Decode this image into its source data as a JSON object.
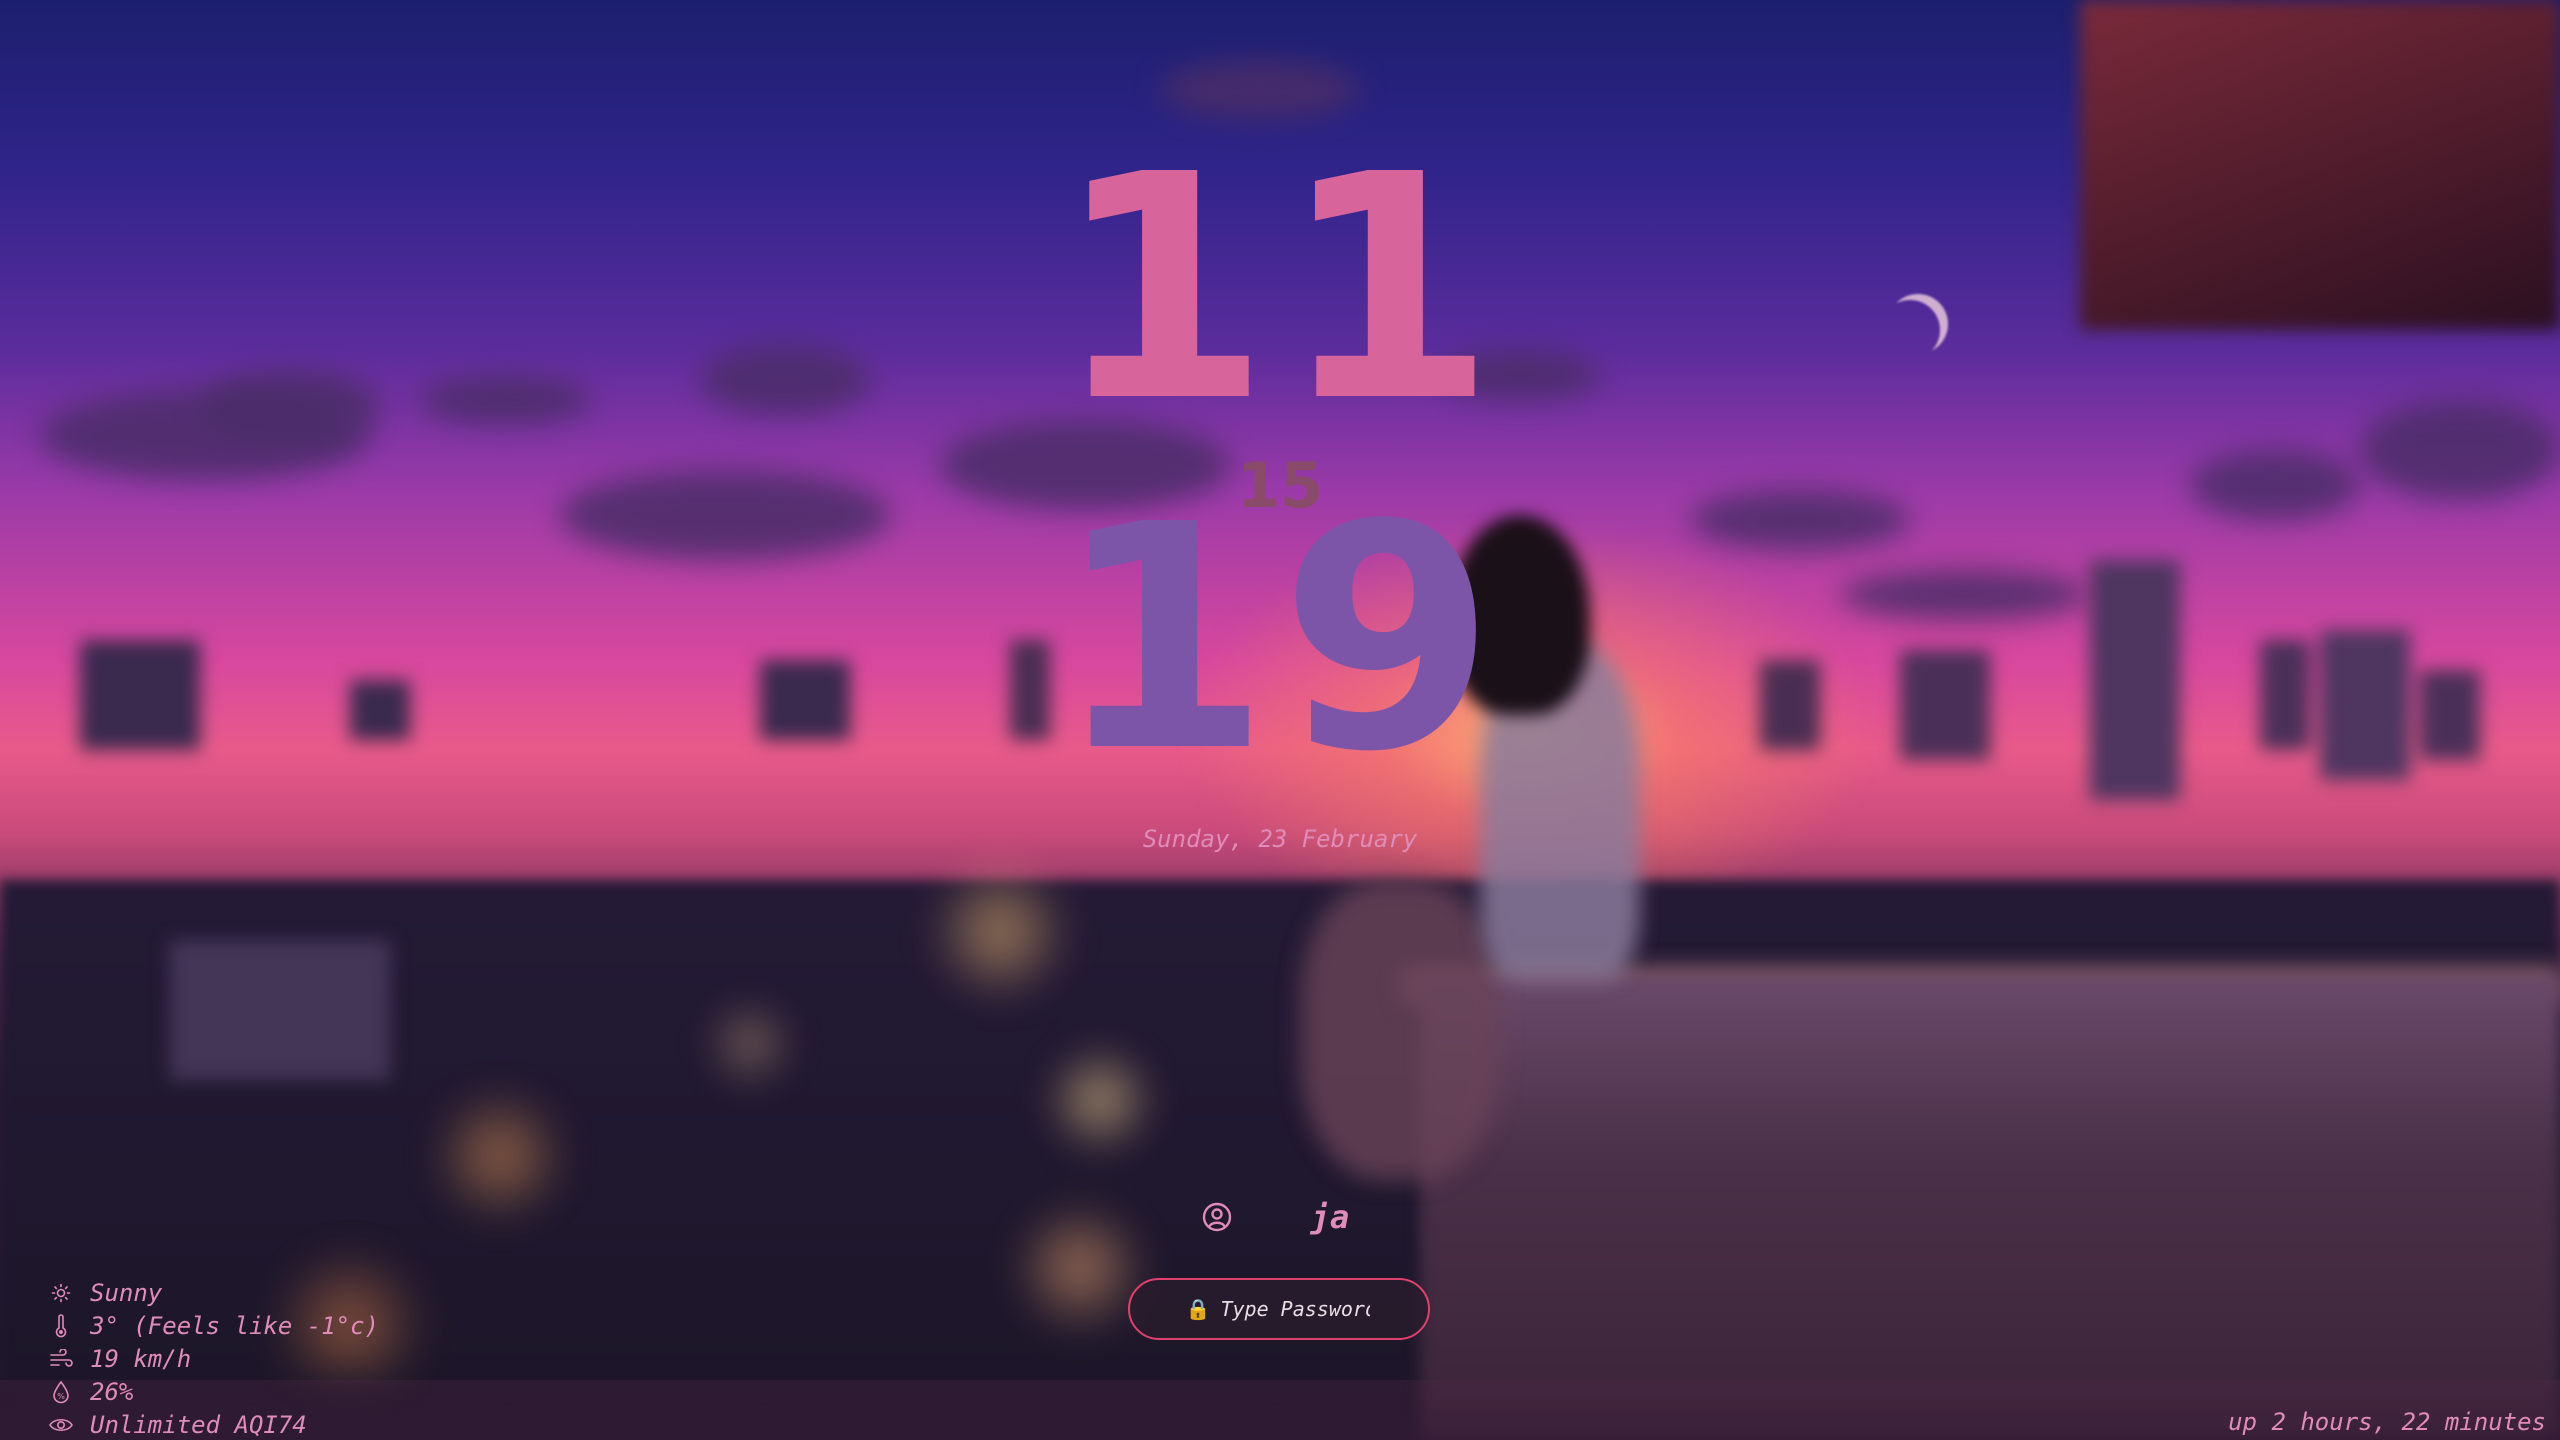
{
  "clock": {
    "hours": "11",
    "seconds": "15",
    "minutes": "19",
    "date": "Sunday, 23 February",
    "hours_color": "#d8649c",
    "minutes_color": "#7c55a8"
  },
  "user": {
    "icon": "user-circle-icon",
    "name": "ja"
  },
  "password": {
    "icon": "lock-icon",
    "placeholder": "Type Password",
    "value": "",
    "border_color": "#e0406c"
  },
  "weather": {
    "items": [
      {
        "icon": "sun-icon",
        "text": "Sunny"
      },
      {
        "icon": "thermometer-icon",
        "text": "3° (Feels like -1°c)"
      },
      {
        "icon": "wind-icon",
        "text": "19 km/h"
      },
      {
        "icon": "droplet-icon",
        "text": "26%"
      },
      {
        "icon": "eye-icon",
        "text": "Unlimited AQI74"
      }
    ]
  },
  "status": {
    "uptime": "up 2 hours, 22 minutes"
  },
  "theme": {
    "text_color": "#e08cb8"
  }
}
